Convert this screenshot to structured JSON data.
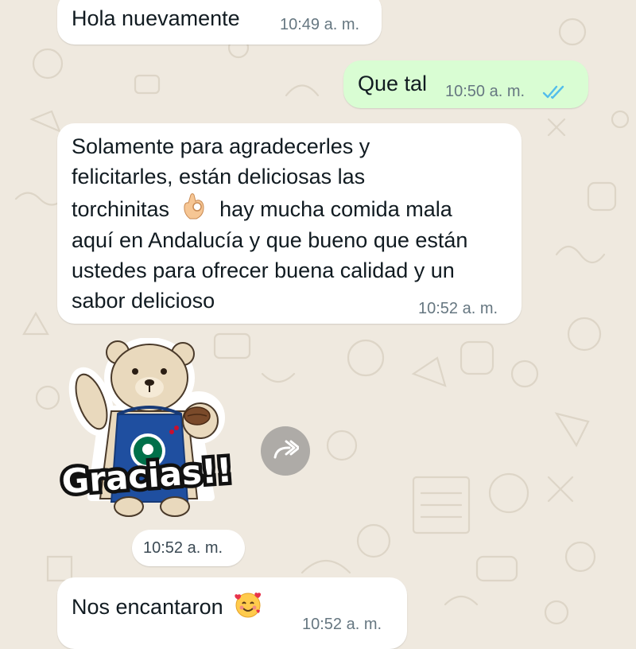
{
  "messages": [
    {
      "text": "Hola nuevamente",
      "time": "10:49 a. m."
    },
    {
      "text": "Que tal",
      "time": "10:50 a. m."
    },
    {
      "lines": [
        "Solamente para agradecerles y",
        "felicitarles, están deliciosas las",
        "torchinitas",
        "hay mucha comida mala",
        "aquí en Andalucía y que bueno que están",
        "ustedes para ofrecer buena calidad y un",
        "sabor delicioso"
      ],
      "time": "10:52 a. m."
    },
    {
      "sticker_text": "Gracias!!",
      "time": "10:52 a. m."
    },
    {
      "text": "Nos encantaron",
      "time": "10:52 a. m."
    }
  ],
  "icons": {
    "read_receipt": "double-check-icon",
    "ok_hand": "ok-hand-emoji",
    "heart_eyes": "smiling-face-with-hearts-emoji",
    "forward": "forward-icon"
  },
  "colors": {
    "outgoing_bubble": "#d9fdd3",
    "incoming_bubble": "#ffffff",
    "read_tick": "#53bdeb",
    "background": "#efe9df"
  }
}
